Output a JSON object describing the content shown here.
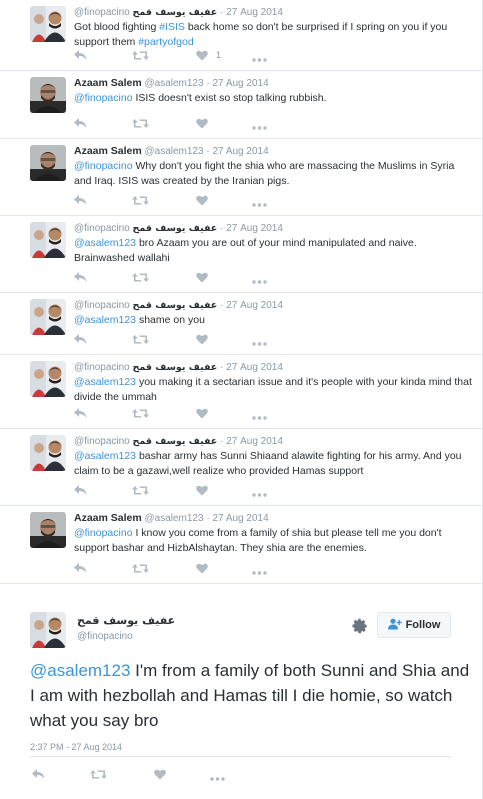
{
  "tweets": [
    {
      "name": "",
      "handle": "@finopacino",
      "name_ar": "عفيف يوسف قمح",
      "time": "27 Aug 2014",
      "parts": [
        {
          "t": "Got blood fighting ",
          "link": false
        },
        {
          "t": "#ISIS",
          "link": true
        },
        {
          "t": "  back home so don't be surprised if I spring on you if you support them ",
          "link": false
        },
        {
          "t": "#partyofgod",
          "link": true
        }
      ],
      "like_count": "1",
      "avatar": "finopacino"
    },
    {
      "name": "Azaam Salem",
      "handle": "@asalem123",
      "name_ar": "",
      "time": "27 Aug 2014",
      "parts": [
        {
          "t": "@finopacino",
          "link": true
        },
        {
          "t": " ISIS doesn't exist so stop talking rubbish.",
          "link": false
        }
      ],
      "like_count": "",
      "avatar": "azaam"
    },
    {
      "name": "Azaam Salem",
      "handle": "@asalem123",
      "name_ar": "",
      "time": "27 Aug 2014",
      "parts": [
        {
          "t": "@finopacino",
          "link": true
        },
        {
          "t": " Why don't you fight the shia who are massacing the Muslims in Syria and Iraq. ISIS was created by the Iranian pigs.",
          "link": false
        }
      ],
      "like_count": "",
      "avatar": "azaam"
    },
    {
      "name": "",
      "handle": "@finopacino",
      "name_ar": "عفيف يوسف قمح",
      "time": "27 Aug 2014",
      "parts": [
        {
          "t": "@asalem123",
          "link": true
        },
        {
          "t": " bro Azaam you are out of your mind manipulated and naive. Brainwashed wallahi",
          "link": false
        }
      ],
      "like_count": "",
      "avatar": "finopacino"
    },
    {
      "name": "",
      "handle": "@finopacino",
      "name_ar": "عفيف يوسف قمح",
      "time": "27 Aug 2014",
      "parts": [
        {
          "t": "@asalem123",
          "link": true
        },
        {
          "t": " shame on you",
          "link": false
        }
      ],
      "like_count": "",
      "avatar": "finopacino"
    },
    {
      "name": "",
      "handle": "@finopacino",
      "name_ar": "عفيف يوسف قمح",
      "time": "27 Aug 2014",
      "parts": [
        {
          "t": "@asalem123",
          "link": true
        },
        {
          "t": " you making it a sectarian issue and it's people with your kinda mind that divide the ummah",
          "link": false
        }
      ],
      "like_count": "",
      "avatar": "finopacino"
    },
    {
      "name": "",
      "handle": "@finopacino",
      "name_ar": "عفيف يوسف قمح",
      "time": "27 Aug 2014",
      "parts": [
        {
          "t": "@asalem123",
          "link": true
        },
        {
          "t": " bashar army has Sunni Shiaand alawite fighting for his army. And you claim to be a gazawi,well realize who provided Hamas support",
          "link": false
        }
      ],
      "like_count": "",
      "avatar": "finopacino"
    },
    {
      "name": "Azaam Salem",
      "handle": "@asalem123",
      "name_ar": "",
      "time": "27 Aug 2014",
      "parts": [
        {
          "t": "@finopacino",
          "link": true
        },
        {
          "t": " I know you come from a family of shia but please tell me you don't support bashar and HizbAlshaytan. They shia are the enemies.",
          "link": false
        }
      ],
      "like_count": "",
      "avatar": "azaam"
    }
  ],
  "separator": "·",
  "permalink": {
    "name_ar": "عفيف يوسف قمح",
    "handle": "@finopacino",
    "follow_label": "Follow",
    "mention": "@asalem123",
    "text": " I'm from a family of both Sunni and Shia and I am with hezbollah and Hamas till I die homie, so watch what you say bro",
    "timestamp": "2:37 PM - 27 Aug 2014"
  },
  "colors": {
    "link": "#3b94d9",
    "text": "#292f33",
    "muted": "#8899a6",
    "icon": "#b1bbc3",
    "border": "#e1e8ed"
  },
  "icons": [
    "reply-icon",
    "retweet-icon",
    "like-icon",
    "more-icon",
    "gear-icon",
    "follow-person-icon"
  ]
}
